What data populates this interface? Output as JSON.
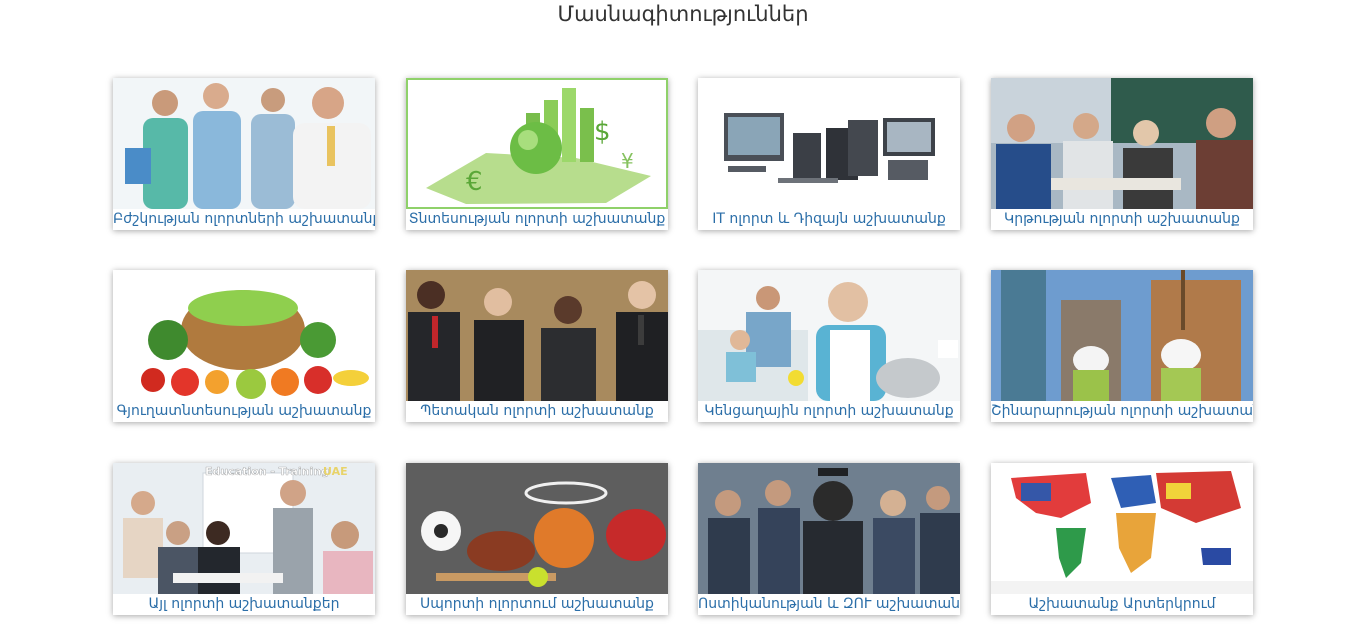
{
  "page": {
    "title": "Մասնագիտություններ"
  },
  "cards": [
    {
      "label": "Բժշկության ոլորտների աշխատանք",
      "image": "medical-staff-image"
    },
    {
      "label": "Տնտեսության ոլորտի աշխատանք",
      "image": "economy-globe-image"
    },
    {
      "label": "IT ոլորտ և Դիզայն աշխատանք",
      "image": "computers-image"
    },
    {
      "label": "Կրթության ոլորտի աշխատանք",
      "image": "students-classroom-image"
    },
    {
      "label": "Գյուղատնտեսության աշխատանք",
      "image": "vegetables-basket-image"
    },
    {
      "label": "Պետական ոլորտի աշխատանք",
      "image": "business-people-image"
    },
    {
      "label": "Կենցաղային ոլորտի աշխատանք",
      "image": "household-cleaning-image"
    },
    {
      "label": "Շինարարության ոլորտի աշխատանք",
      "image": "construction-site-image"
    },
    {
      "label": "Այլ ոլորտի աշխատանքեր",
      "image": "training-meeting-image",
      "overlay_text": "Education - Training",
      "overlay_badge": "UAE"
    },
    {
      "label": "Սպորտի ոլորտում աշխատանք",
      "image": "sports-balls-image"
    },
    {
      "label": "Ոստիկանության և ԶՈՒ աշխատանք",
      "image": "police-officers-image"
    },
    {
      "label": "Աշխատանք Արտերկրում",
      "image": "world-flags-map-image"
    }
  ],
  "colors": {
    "caption": "#2b6ea8",
    "selected_border": "#8fd16a"
  }
}
